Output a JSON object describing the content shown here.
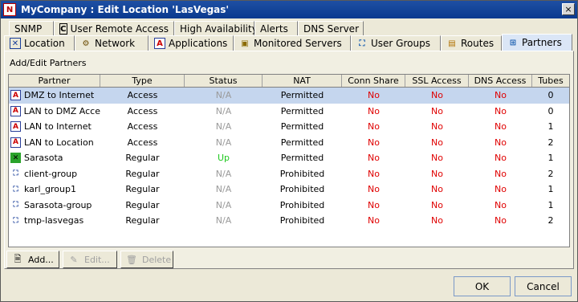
{
  "window": {
    "title": "MyCompany : Edit Location 'LasVegas'",
    "logo": "N",
    "close": "×"
  },
  "tabs_row1": [
    {
      "label": "SNMP"
    },
    {
      "label": "User Remote Access",
      "icon": "C"
    },
    {
      "label": "High Availability"
    },
    {
      "label": "Alerts"
    },
    {
      "label": "DNS Server"
    }
  ],
  "tabs_row2": [
    {
      "label": "Location",
      "icon": "location-icon"
    },
    {
      "label": "Network",
      "icon": "network-icon"
    },
    {
      "label": "Applications",
      "icon": "A"
    },
    {
      "label": "Monitored Servers",
      "icon": "monitored-servers-icon"
    },
    {
      "label": "User Groups",
      "icon": "user-groups-icon"
    },
    {
      "label": "Routes",
      "icon": "routes-icon"
    },
    {
      "label": "Partners",
      "icon": "partners-icon"
    }
  ],
  "panel": {
    "label": "Add/Edit Partners"
  },
  "table": {
    "headers": [
      "Partner",
      "Type",
      "Status",
      "NAT",
      "Conn Share",
      "SSL Access",
      "DNS Access",
      "Tubes"
    ],
    "rows": [
      {
        "icon": "A",
        "partner": "DMZ to Internet",
        "type": "Access",
        "status": "N/A",
        "nat": "Permitted",
        "conn": "No",
        "ssl": "No",
        "dns": "No",
        "tubes": "0"
      },
      {
        "icon": "A",
        "partner": "LAN to DMZ Acce",
        "type": "Access",
        "status": "N/A",
        "nat": "Permitted",
        "conn": "No",
        "ssl": "No",
        "dns": "No",
        "tubes": "0"
      },
      {
        "icon": "A",
        "partner": "LAN to Internet",
        "type": "Access",
        "status": "N/A",
        "nat": "Permitted",
        "conn": "No",
        "ssl": "No",
        "dns": "No",
        "tubes": "1"
      },
      {
        "icon": "A",
        "partner": "LAN to Location",
        "type": "Access",
        "status": "N/A",
        "nat": "Permitted",
        "conn": "No",
        "ssl": "No",
        "dns": "No",
        "tubes": "2"
      },
      {
        "icon": "S",
        "partner": "Sarasota",
        "type": "Regular",
        "status": "Up",
        "nat": "Permitted",
        "conn": "No",
        "ssl": "No",
        "dns": "No",
        "tubes": "1"
      },
      {
        "icon": "G",
        "partner": "client-group",
        "type": "Regular",
        "status": "N/A",
        "nat": "Prohibited",
        "conn": "No",
        "ssl": "No",
        "dns": "No",
        "tubes": "2"
      },
      {
        "icon": "G",
        "partner": "karl_group1",
        "type": "Regular",
        "status": "N/A",
        "nat": "Prohibited",
        "conn": "No",
        "ssl": "No",
        "dns": "No",
        "tubes": "1"
      },
      {
        "icon": "G",
        "partner": "Sarasota-group",
        "type": "Regular",
        "status": "N/A",
        "nat": "Prohibited",
        "conn": "No",
        "ssl": "No",
        "dns": "No",
        "tubes": "1"
      },
      {
        "icon": "G",
        "partner": "tmp-lasvegas",
        "type": "Regular",
        "status": "N/A",
        "nat": "Prohibited",
        "conn": "No",
        "ssl": "No",
        "dns": "No",
        "tubes": "2"
      }
    ]
  },
  "buttons": {
    "add": "Add...",
    "edit": "Edit...",
    "delete": "Delete",
    "ok": "OK",
    "cancel": "Cancel"
  },
  "colors": {
    "red": "#e00000",
    "green": "#1ec81e",
    "selected": "#c5d6ee"
  }
}
